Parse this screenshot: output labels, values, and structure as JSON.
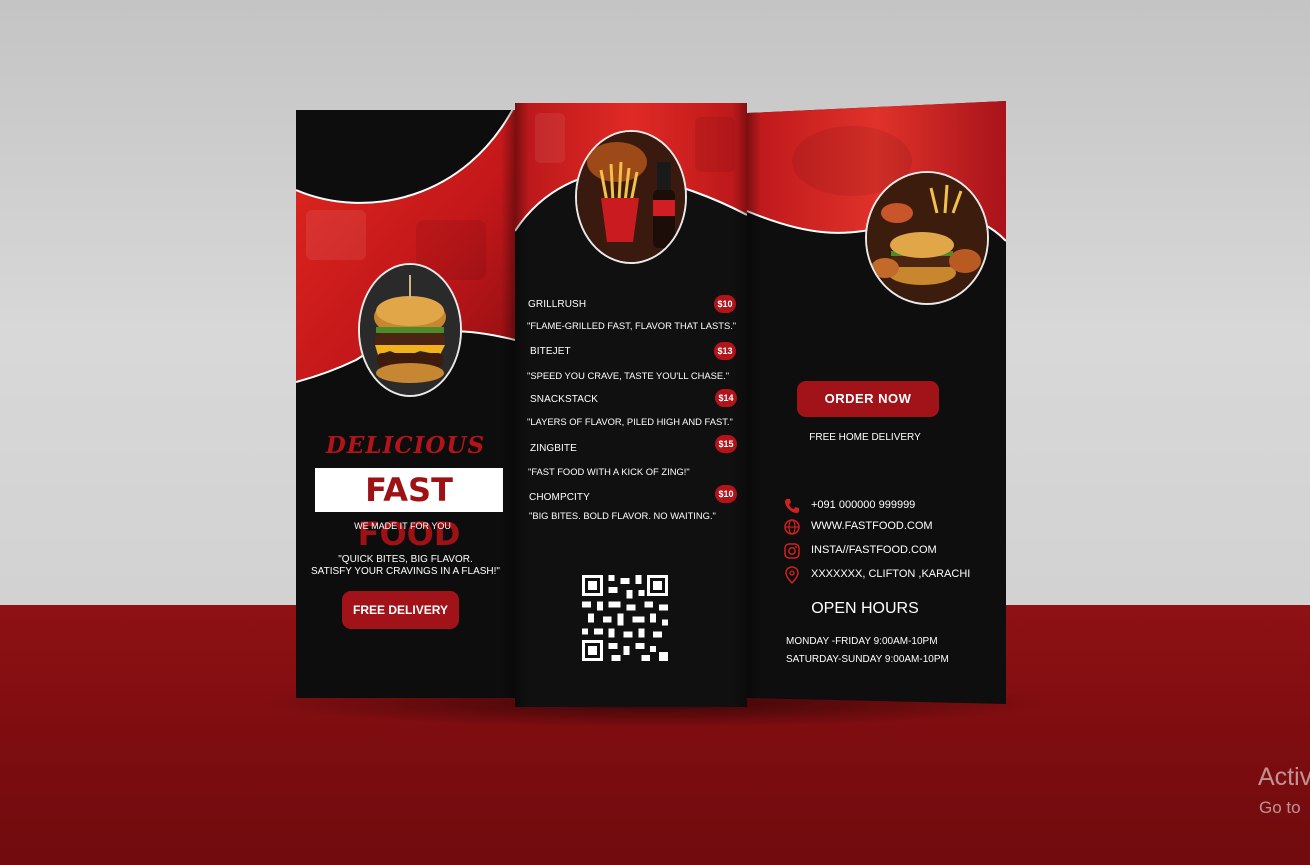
{
  "colors": {
    "accent_red": "#b3141a",
    "panel_black": "#0e0e0e",
    "wall": "#cfcfcf",
    "floor": "#7e0d10"
  },
  "left_panel": {
    "headline_script": "DELICIOUS",
    "headline_main": "FAST FOOD",
    "tagline": "WE MADE IT FOR YOU",
    "quote_line1": "\"QUICK BITES, BIG FLAVOR.",
    "quote_line2": "SATISFY YOUR CRAVINGS IN A FLASH!\"",
    "cta": "FREE DELIVERY",
    "image_icon": "burger-photo"
  },
  "middle_panel": {
    "image_icon": "fries-and-cola-photo",
    "menu": [
      {
        "name": "GRILLRUSH",
        "price": "$10",
        "desc": "\"FLAME-GRILLED FAST, FLAVOR THAT LASTS.\""
      },
      {
        "name": "BITEJET",
        "price": "$13",
        "desc": "\"SPEED YOU CRAVE, TASTE YOU'LL CHASE.\""
      },
      {
        "name": "SNACKSTACK",
        "price": "$14",
        "desc": "\"LAYERS OF FLAVOR, PILED HIGH AND FAST.\""
      },
      {
        "name": "ZINGBITE",
        "price": "$15",
        "desc": "\"FAST FOOD WITH A KICK OF ZING!\""
      },
      {
        "name": "CHOMPCITY",
        "price": "$10",
        "desc": "\"BIG BITES. BOLD FLAVOR. NO WAITING.\""
      }
    ],
    "qr_icon": "qr-code"
  },
  "right_panel": {
    "image_icon": "burger-combo-photo",
    "order_button": "ORDER NOW",
    "delivery_note": "FREE HOME DELIVERY",
    "contacts": [
      {
        "icon": "phone-icon",
        "text": "+091 000000 999999"
      },
      {
        "icon": "globe-icon",
        "text": "WWW.FASTFOOD.COM"
      },
      {
        "icon": "instagram-icon",
        "text": "INSTA//FASTFOOD.COM"
      },
      {
        "icon": "location-pin-icon",
        "text": "XXXXXXX, CLIFTON ,KARACHI"
      }
    ],
    "hours_title": "OPEN HOURS",
    "hours_line1": "MONDAY -FRIDAY 9:00AM-10PM",
    "hours_line2": "SATURDAY-SUNDAY 9:00AM-10PM"
  },
  "os_watermark": {
    "line1": "Activ",
    "line2": "Go to"
  }
}
